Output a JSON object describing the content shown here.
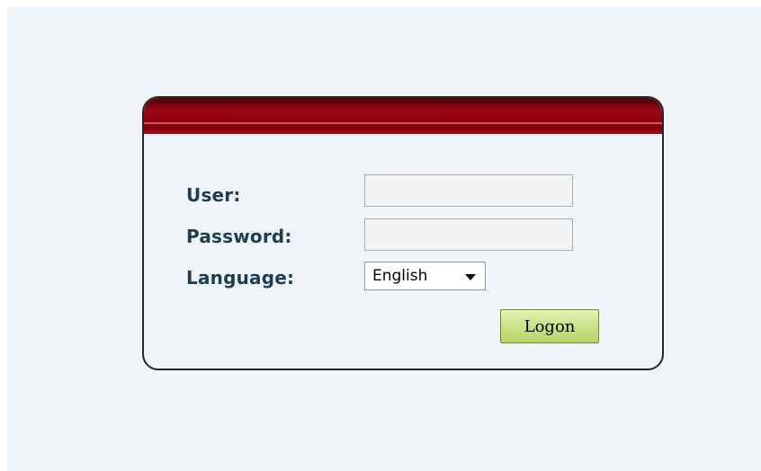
{
  "login": {
    "user_label": "User:",
    "password_label": "Password:",
    "language_label": "Language:",
    "user_value": "",
    "password_value": "",
    "language_selected": "English",
    "logon_button": "Logon"
  },
  "colors": {
    "page_background": "#eef4f7",
    "header_red": "#9c0614",
    "label_text": "#1e3d52",
    "button_green": "#c9e288",
    "panel_border": "#2a2424"
  },
  "icons": {
    "language_dropdown": "chevron-down-icon"
  }
}
